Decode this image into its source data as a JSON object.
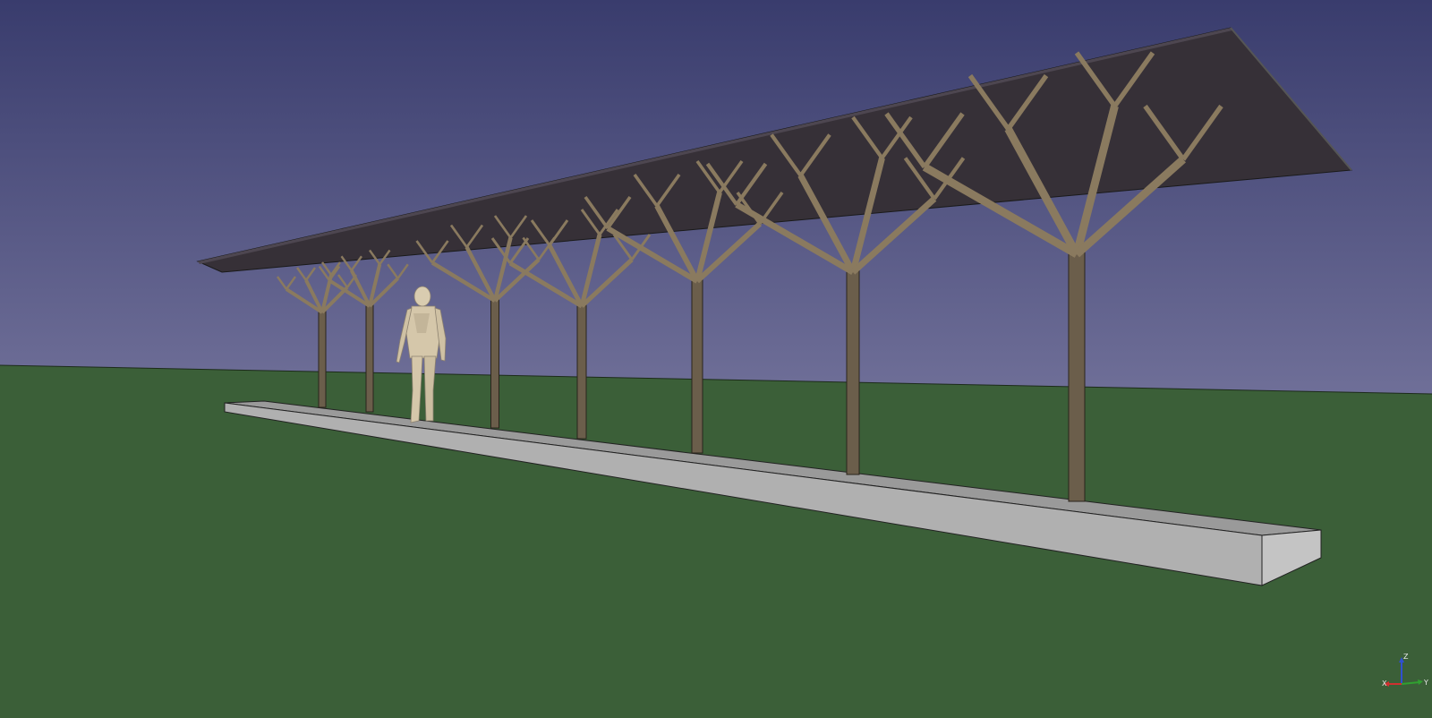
{
  "viewport": {
    "background_sky_top": "#393c6d",
    "background_sky_bottom": "#6f6f98",
    "ground_color": "#3b5f38"
  },
  "model": {
    "roof_color": "#363037",
    "column_color": "#6b5e4b",
    "branch_color": "#8a7a5f",
    "platform_color": "#9a9a9a",
    "platform_side_color": "#b8b8b8",
    "figure_color": "#d9ccb0"
  },
  "axis_triad": {
    "z_label": "Z",
    "x_label": "X",
    "y_label": "Y",
    "x_color": "#d03030",
    "y_color": "#30a030",
    "z_color": "#3050d0"
  }
}
